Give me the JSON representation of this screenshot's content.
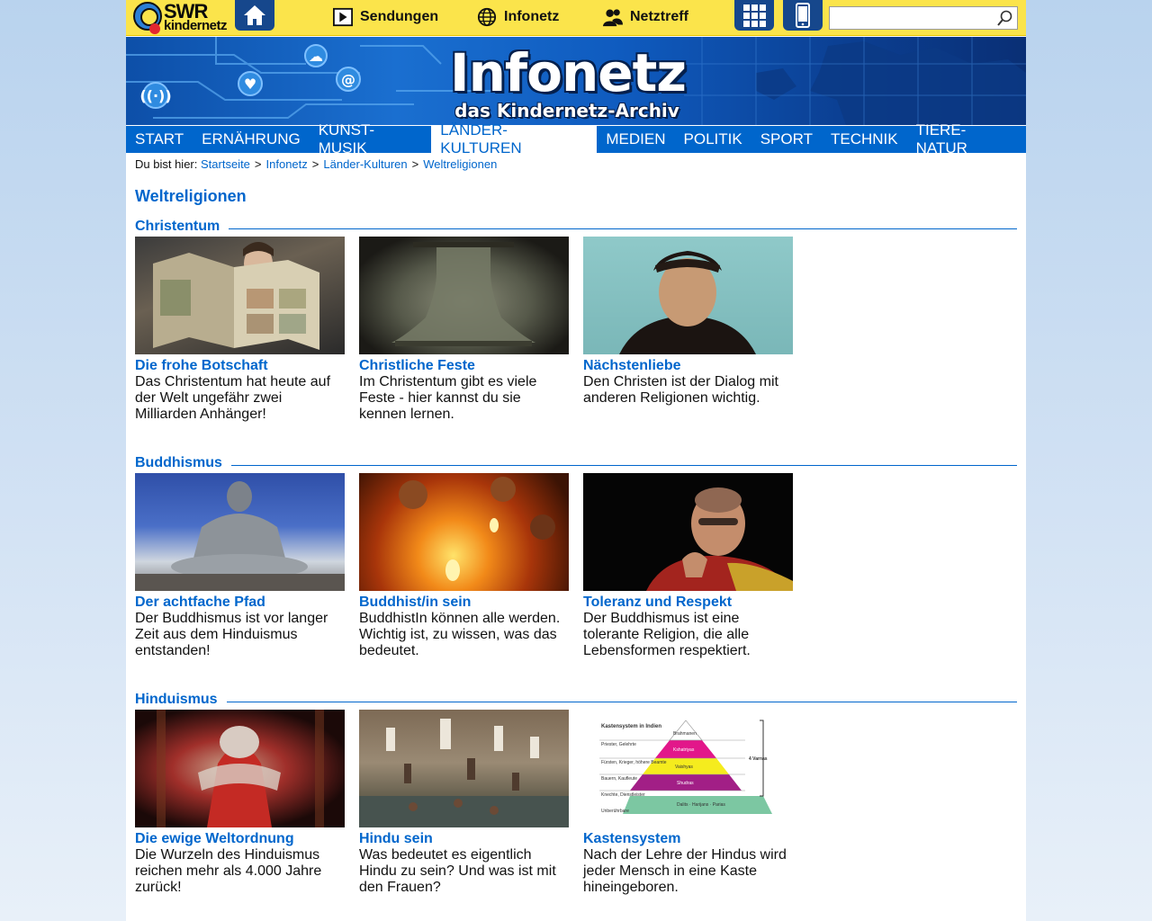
{
  "header": {
    "logo": {
      "line1": "SWR",
      "line2": "kindernetz"
    },
    "nav": [
      {
        "label": "Sendungen",
        "icon": "play-icon"
      },
      {
        "label": "Infonetz",
        "icon": "globe-icon"
      },
      {
        "label": "Netztreff",
        "icon": "people-icon"
      }
    ],
    "search": {
      "placeholder": "",
      "value": ""
    }
  },
  "banner": {
    "title": "Infonetz",
    "subtitle": "das Kindernetz-Archiv"
  },
  "categories": [
    {
      "label": "START",
      "active": false
    },
    {
      "label": "ERNÄHRUNG",
      "active": false
    },
    {
      "label": "KUNST-MUSIK",
      "active": false
    },
    {
      "label": "LÄNDER-KULTUREN",
      "active": true
    },
    {
      "label": "MEDIEN",
      "active": false
    },
    {
      "label": "POLITIK",
      "active": false
    },
    {
      "label": "SPORT",
      "active": false
    },
    {
      "label": "TECHNIK",
      "active": false
    },
    {
      "label": "TIERE-NATUR",
      "active": false
    }
  ],
  "breadcrumb": {
    "prefix": "Du bist hier:",
    "items": [
      "Startseite",
      "Infonetz",
      "Länder-Kulturen",
      "Weltreligionen"
    ],
    "separator": ">"
  },
  "page_title": "Weltreligionen",
  "sections": [
    {
      "title": "Christentum",
      "cards": [
        {
          "title": "Die frohe Botschaft",
          "text": "Das Christentum hat heute auf der Welt ungefähr zwei Milliarden Anhänger!"
        },
        {
          "title": "Christliche Feste",
          "text": "Im Christentum gibt es viele Feste - hier kannst du sie kennen lernen."
        },
        {
          "title": "Nächstenliebe",
          "text": "Den Christen ist der Dialog mit anderen Religionen wichtig."
        }
      ]
    },
    {
      "title": "Buddhismus",
      "cards": [
        {
          "title": "Der achtfache Pfad",
          "text": "Der Buddhismus ist vor langer Zeit aus dem Hinduismus entstanden!"
        },
        {
          "title": "Buddhist/in sein",
          "text": "BuddhistIn können alle werden. Wichtig ist, zu wissen, was das bedeutet."
        },
        {
          "title": "Toleranz und Respekt",
          "text": "Der Buddhismus ist eine tolerante Religion, die alle Lebensformen respektiert."
        }
      ]
    },
    {
      "title": "Hinduismus",
      "cards": [
        {
          "title": "Die ewige Weltordnung",
          "text": "Die Wurzeln des Hinduismus reichen mehr als 4.000 Jahre zurück!"
        },
        {
          "title": "Hindu sein",
          "text": "Was bedeutet es eigentlich Hindu zu sein? Und was ist mit den Frauen?"
        },
        {
          "title": "Kastensystem",
          "text": "Nach der Lehre der Hindus wird jeder Mensch in eine Kaste hineingeboren."
        }
      ]
    }
  ],
  "caste_chart": {
    "title": "Kastensystem in Indien",
    "rows": [
      {
        "left": "Priester, Gelehrte",
        "right": "Brahmanen",
        "color": "#ffffff"
      },
      {
        "left": "Fürsten, Krieger, höhere Beamte",
        "right": "Kshatriyas",
        "color": "#e2178a"
      },
      {
        "left": "Bauern, Kaufleute",
        "right": "Vaishyas",
        "color": "#f5ec1e"
      },
      {
        "left": "Knechte, Dienstleister",
        "right": "Shudras",
        "color": "#a21f86"
      },
      {
        "left": "Unberührbare",
        "right": "Dalits · Harijans · Parias",
        "color": "#7cc7a2"
      }
    ],
    "bracket_label": "4 Varnas"
  },
  "colors": {
    "brand_blue": "#0066cc",
    "topbar_yellow": "#fbe44b",
    "dark_blue": "#16478c"
  }
}
